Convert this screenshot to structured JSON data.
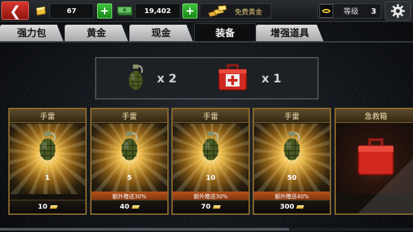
{
  "topbar": {
    "back_glyph": "❮",
    "gold_amount": "67",
    "cash_amount": "19,402",
    "plus_glyph": "+",
    "free_gold_label": "免费黄金",
    "level_label": "等级",
    "level_value": "3"
  },
  "tabs": [
    {
      "label": "强力包",
      "active": false
    },
    {
      "label": "黄金",
      "active": false
    },
    {
      "label": "现金",
      "active": false
    },
    {
      "label": "装备",
      "active": true
    },
    {
      "label": "增强道具",
      "active": false
    }
  ],
  "inventory": [
    {
      "icon": "grenade-icon",
      "count": "x 2"
    },
    {
      "icon": "medkit-icon",
      "count": "x 1"
    }
  ],
  "cards": [
    {
      "title": "手雷",
      "icon": "grenade-icon",
      "quantity": "1",
      "bonus": "",
      "price": "10"
    },
    {
      "title": "手雷",
      "icon": "grenade-icon",
      "quantity": "5",
      "bonus": "额外赠送30%",
      "price": "40"
    },
    {
      "title": "手雷",
      "icon": "grenade-icon",
      "quantity": "10",
      "bonus": "额外赠送30%",
      "price": "70"
    },
    {
      "title": "手雷",
      "icon": "grenade-icon",
      "quantity": "50",
      "bonus": "额外赠送40%",
      "price": "300"
    },
    {
      "title": "急救箱",
      "icon": "medkit-icon",
      "quantity": "",
      "bonus": "",
      "price": ""
    }
  ],
  "colors": {
    "accent_gold": "#e8b646",
    "back_red": "#d8342d",
    "plus_green": "#3ec13b",
    "bonus_orange": "#b6531d",
    "card_border": "#8c6a2d"
  }
}
